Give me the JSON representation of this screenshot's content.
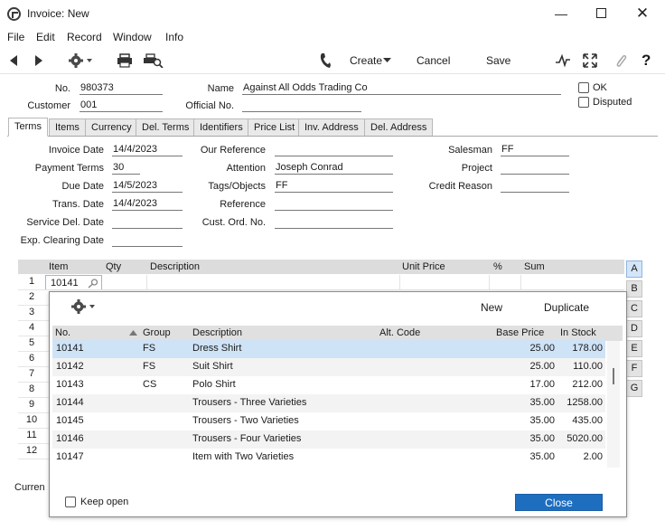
{
  "window": {
    "title": "Invoice: New"
  },
  "menu": [
    "File",
    "Edit",
    "Record",
    "Window",
    "Info"
  ],
  "toolbar": {
    "create": "Create",
    "cancel": "Cancel",
    "save": "Save"
  },
  "header": {
    "no_label": "No.",
    "no_value": "980373",
    "name_label": "Name",
    "name_value": "Against All Odds Trading Co",
    "customer_label": "Customer",
    "customer_value": "001",
    "official_label": "Official No.",
    "official_value": "",
    "ok_label": "OK",
    "disputed_label": "Disputed"
  },
  "tabs": [
    "Terms",
    "Items",
    "Currency",
    "Del. Terms",
    "Identifiers",
    "Price List",
    "Inv. Address",
    "Del. Address"
  ],
  "terms": {
    "invoice_date_label": "Invoice Date",
    "invoice_date": "14/4/2023",
    "payment_terms_label": "Payment Terms",
    "payment_terms": "30",
    "due_date_label": "Due Date",
    "due_date": "14/5/2023",
    "trans_date_label": "Trans. Date",
    "trans_date": "14/4/2023",
    "service_del_label": "Service Del. Date",
    "service_del": "",
    "exp_clearing_label": "Exp. Clearing Date",
    "exp_clearing": "",
    "our_ref_label": "Our Reference",
    "our_ref": "",
    "attention_label": "Attention",
    "attention": "Joseph Conrad",
    "tags_label": "Tags/Objects",
    "tags": "FF",
    "reference_label": "Reference",
    "reference": "",
    "cust_ord_label": "Cust. Ord. No.",
    "cust_ord": "",
    "salesman_label": "Salesman",
    "salesman": "FF",
    "project_label": "Project",
    "project": "",
    "credit_reason_label": "Credit Reason",
    "credit_reason": ""
  },
  "matrix": {
    "headers": {
      "item": "Item",
      "qty": "Qty",
      "description": "Description",
      "unit_price": "Unit Price",
      "pct": "%",
      "sum": "Sum"
    },
    "row_numbers": [
      "1",
      "2",
      "3",
      "4",
      "5",
      "6",
      "7",
      "8",
      "9",
      "10",
      "11",
      "12"
    ],
    "row1_item": "10141",
    "side_tabs": [
      "A",
      "B",
      "C",
      "D",
      "E",
      "F",
      "G"
    ],
    "currency_partial": "Curren"
  },
  "popup": {
    "new": "New",
    "duplicate": "Duplicate",
    "headers": {
      "no": "No.",
      "group": "Group",
      "description": "Description",
      "alt_code": "Alt. Code",
      "base_price": "Base Price",
      "in_stock": "In Stock"
    },
    "rows": [
      {
        "no": "10141",
        "group": "FS",
        "description": "Dress Shirt",
        "alt": "",
        "price": "25.00",
        "stock": "178.00"
      },
      {
        "no": "10142",
        "group": "FS",
        "description": "Suit Shirt",
        "alt": "",
        "price": "25.00",
        "stock": "110.00"
      },
      {
        "no": "10143",
        "group": "CS",
        "description": "Polo Shirt",
        "alt": "",
        "price": "17.00",
        "stock": "212.00"
      },
      {
        "no": "10144",
        "group": "",
        "description": "Trousers - Three Varieties",
        "alt": "",
        "price": "35.00",
        "stock": "1258.00"
      },
      {
        "no": "10145",
        "group": "",
        "description": "Trousers - Two Varieties",
        "alt": "",
        "price": "35.00",
        "stock": "435.00"
      },
      {
        "no": "10146",
        "group": "",
        "description": "Trousers - Four Varieties",
        "alt": "",
        "price": "35.00",
        "stock": "5020.00"
      },
      {
        "no": "10147",
        "group": "",
        "description": "Item with Two Varieties",
        "alt": "",
        "price": "35.00",
        "stock": "2.00"
      }
    ],
    "keep_open": "Keep open",
    "close": "Close"
  }
}
